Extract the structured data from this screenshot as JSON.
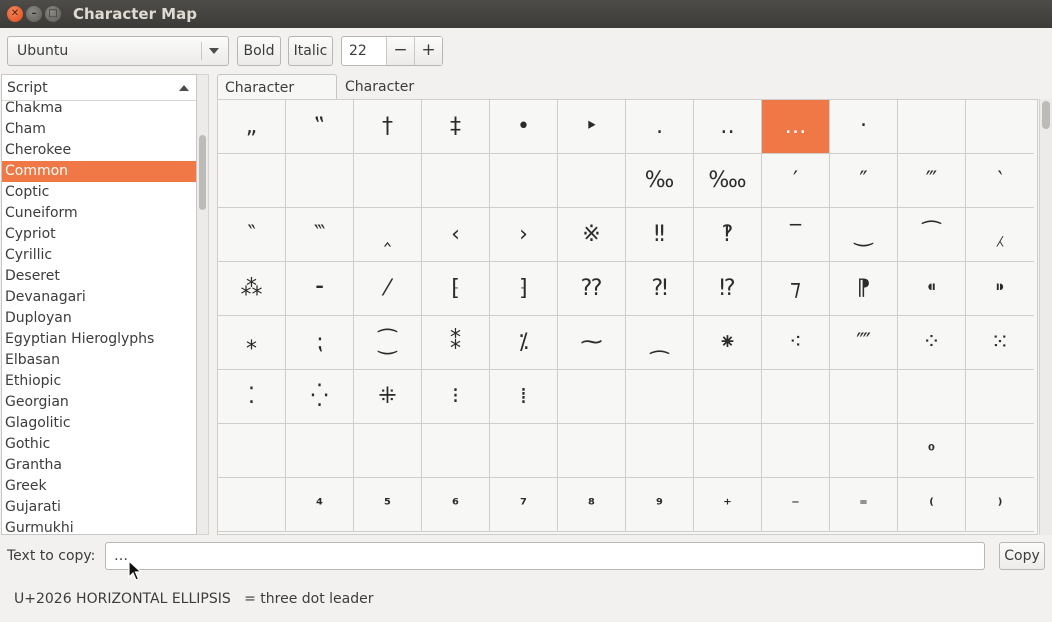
{
  "window": {
    "title": "Character Map"
  },
  "toolbar": {
    "font": "Ubuntu",
    "bold_label": "Bold",
    "italic_label": "Italic",
    "size": "22",
    "minus": "−",
    "plus": "+"
  },
  "script_list": {
    "header": "Script",
    "items": [
      "Chakma",
      "Cham",
      "Cherokee",
      "Common",
      "Coptic",
      "Cuneiform",
      "Cypriot",
      "Cyrillic",
      "Deseret",
      "Devanagari",
      "Duployan",
      "Egyptian Hieroglyphs",
      "Elbasan",
      "Ethiopic",
      "Georgian",
      "Glagolitic",
      "Gothic",
      "Grantha",
      "Greek",
      "Gujarati",
      "Gurmukhi"
    ],
    "selected": "Common"
  },
  "tabs": {
    "table": "Character Table",
    "details": "Character Details"
  },
  "grid": {
    "selected": "…",
    "rows": [
      [
        "„",
        "‟",
        "†",
        "‡",
        "•",
        "‣",
        "․",
        "‥",
        "…",
        "‧",
        "",
        ""
      ],
      [
        "",
        "",
        "",
        "",
        "",
        "",
        "‰",
        "‱",
        "′",
        "″",
        "‴",
        "‵"
      ],
      [
        "‶",
        "‷",
        "‸",
        "‹",
        "›",
        "※",
        "‼",
        "‽",
        "‾",
        "‿",
        "⁀",
        "⁁"
      ],
      [
        "⁂",
        "⁃",
        "⁄",
        "⁅",
        "⁆",
        "⁇",
        "⁈",
        "⁉",
        "⁊",
        "⁋",
        "⁌",
        "⁍"
      ],
      [
        "⁎",
        "⁏",
        "⁐",
        "⁑",
        "⁒",
        "⁓",
        "⁔",
        "⁕",
        "⁖",
        "⁗",
        "⁘",
        "⁙"
      ],
      [
        "⁚",
        "⁛",
        "⁜",
        "⁝",
        "⁞",
        "",
        "",
        "",
        "",
        "",
        "",
        ""
      ],
      [
        "",
        "",
        "",
        "",
        "",
        "",
        "",
        "",
        "",
        "",
        "⁰",
        ""
      ],
      [
        "",
        "⁴",
        "⁵",
        "⁶",
        "⁷",
        "⁸",
        "⁹",
        "⁺",
        "⁻",
        "⁼",
        "⁽",
        "⁾"
      ]
    ]
  },
  "copy": {
    "label": "Text to copy:",
    "value": "…",
    "button": "Copy"
  },
  "status": {
    "text": "U+2026 HORIZONTAL ELLIPSIS   = three dot leader"
  }
}
